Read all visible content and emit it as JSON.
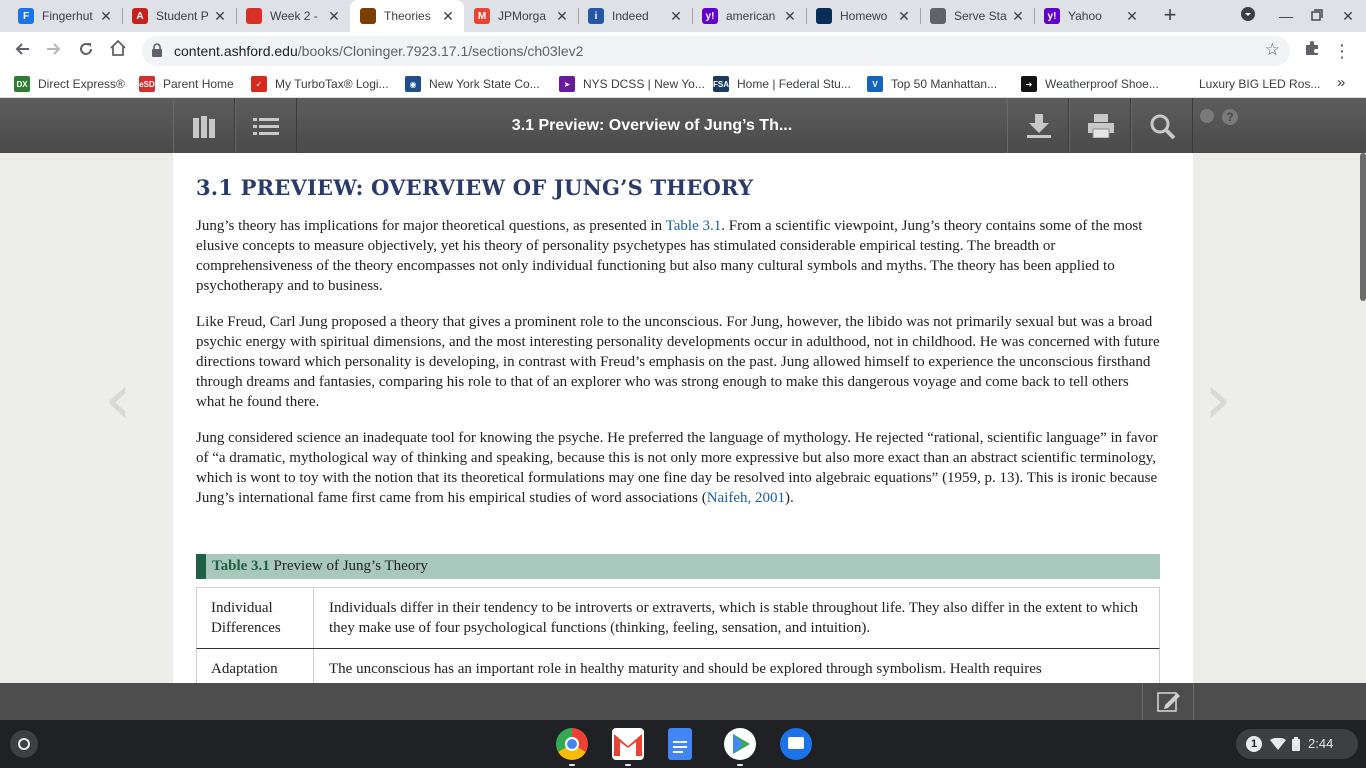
{
  "tabs": [
    {
      "title": "Fingerhut",
      "icon": "f-icon",
      "color": "#1a73e8",
      "glyph": "F"
    },
    {
      "title": "Student P",
      "icon": "a-icon",
      "color": "#c5221f",
      "glyph": "A"
    },
    {
      "title": "Week 2 - ",
      "icon": "spinner-icon",
      "color": "#d93025",
      "glyph": ""
    },
    {
      "title": "Theories",
      "icon": "shield-icon",
      "color": "#7b3f00",
      "glyph": ""
    },
    {
      "title": "JPMorga",
      "icon": "gmail-icon",
      "color": "#ea4335",
      "glyph": "M"
    },
    {
      "title": "Indeed",
      "icon": "indeed-icon",
      "color": "#2557a7",
      "glyph": "i"
    },
    {
      "title": "american",
      "icon": "yahoo-icon",
      "color": "#6001d2",
      "glyph": "y!"
    },
    {
      "title": "Homewo",
      "icon": "circle-icon",
      "color": "#0b2e59",
      "glyph": ""
    },
    {
      "title": "Serve Sta",
      "icon": "globe-icon",
      "color": "#5f6368",
      "glyph": ""
    },
    {
      "title": "Yahoo",
      "icon": "yahoo-icon",
      "color": "#6001d2",
      "glyph": "y!"
    }
  ],
  "url": {
    "host": "content.ashford.edu",
    "path": "/books/Cloninger.7923.17.1/sections/ch03lev2"
  },
  "bookmarks": [
    {
      "label": "Direct Express®",
      "glyph": "DX",
      "color": "#2e7d32"
    },
    {
      "label": "Parent Home",
      "glyph": "eSD",
      "color": "#d32f2f"
    },
    {
      "label": "My TurboTax® Logi...",
      "glyph": "✓",
      "color": "#d52b1e"
    },
    {
      "label": "New York State Co...",
      "glyph": "◉",
      "color": "#1f4e8c"
    },
    {
      "label": "NYS DCSS | New Yo...",
      "glyph": "➤",
      "color": "#6a1b9a"
    },
    {
      "label": "Home | Federal Stu...",
      "glyph": "FSA",
      "color": "#1b3b5c"
    },
    {
      "label": "Top 50 Manhattan...",
      "glyph": "V",
      "color": "#1565c0"
    },
    {
      "label": "Weatherproof Shoe...",
      "glyph": "➔",
      "color": "#111111"
    },
    {
      "label": "Luxury BIG LED Ros...",
      "glyph": "",
      "color": "#ffffff"
    }
  ],
  "bookmarks_more": "»",
  "reader": {
    "title": "3.1 Preview: Overview of Jung’s Th..."
  },
  "content": {
    "heading": "3.1 PREVIEW: OVERVIEW OF JUNG’S THEORY",
    "p1_a": "Jung’s theory has implications for major theoretical questions, as presented in ",
    "p1_link": "Table 3.1",
    "p1_b": ". From a scientific viewpoint, Jung’s theory contains some of the most elusive concepts to measure objectively, yet his theory of personality psychetypes has stimulated considerable empirical testing. The breadth or comprehensiveness of the theory encompasses not only individual functioning but also many cultural symbols and myths. The theory has been applied to psychotherapy and to business.",
    "p2": "Like Freud, Carl Jung proposed a theory that gives a prominent role to the unconscious. For Jung, however, the libido was not primarily sexual but was a broad psychic energy with spiritual dimensions, and the most interesting personality developments occur in adulthood, not in childhood. He was concerned with future directions toward which personality is developing, in contrast with Freud’s emphasis on the past. Jung allowed himself to experience the unconscious firsthand through dreams and fantasies, comparing his role to that of an explorer who was strong enough to make this dangerous voyage and come back to tell others what he found there.",
    "p3_a": "Jung considered science an inadequate tool for knowing the psyche. He preferred the language of mythology. He rejected “rational, scientific language” in favor of “a dramatic, mythological way of thinking and speaking, because this is not only more expressive but also more exact than an abstract scientific terminology, which is wont to toy with the notion that its theoretical formulations may one fine day be resolved into algebraic equations” (1959, p. 13). This is ironic because Jung’s international fame first came from his empirical studies of word associations (",
    "p3_link": "Naifeh, 2001",
    "p3_b": ").",
    "table_label": "Table 3.1",
    "table_title": " Preview of Jung’s Theory",
    "rows": [
      {
        "term": "Individual Differences",
        "desc": "Individuals differ in their tendency to be introverts or extraverts, which is stable throughout life. They also differ in the extent to which they make use of four psychological functions (thinking, feeling, sensation, and intuition)."
      },
      {
        "term": "Adaptation",
        "desc": "The unconscious has an important role in healthy maturity and should be explored through symbolism. Health requires"
      }
    ]
  },
  "clock": "2:44",
  "notification_count": "1"
}
